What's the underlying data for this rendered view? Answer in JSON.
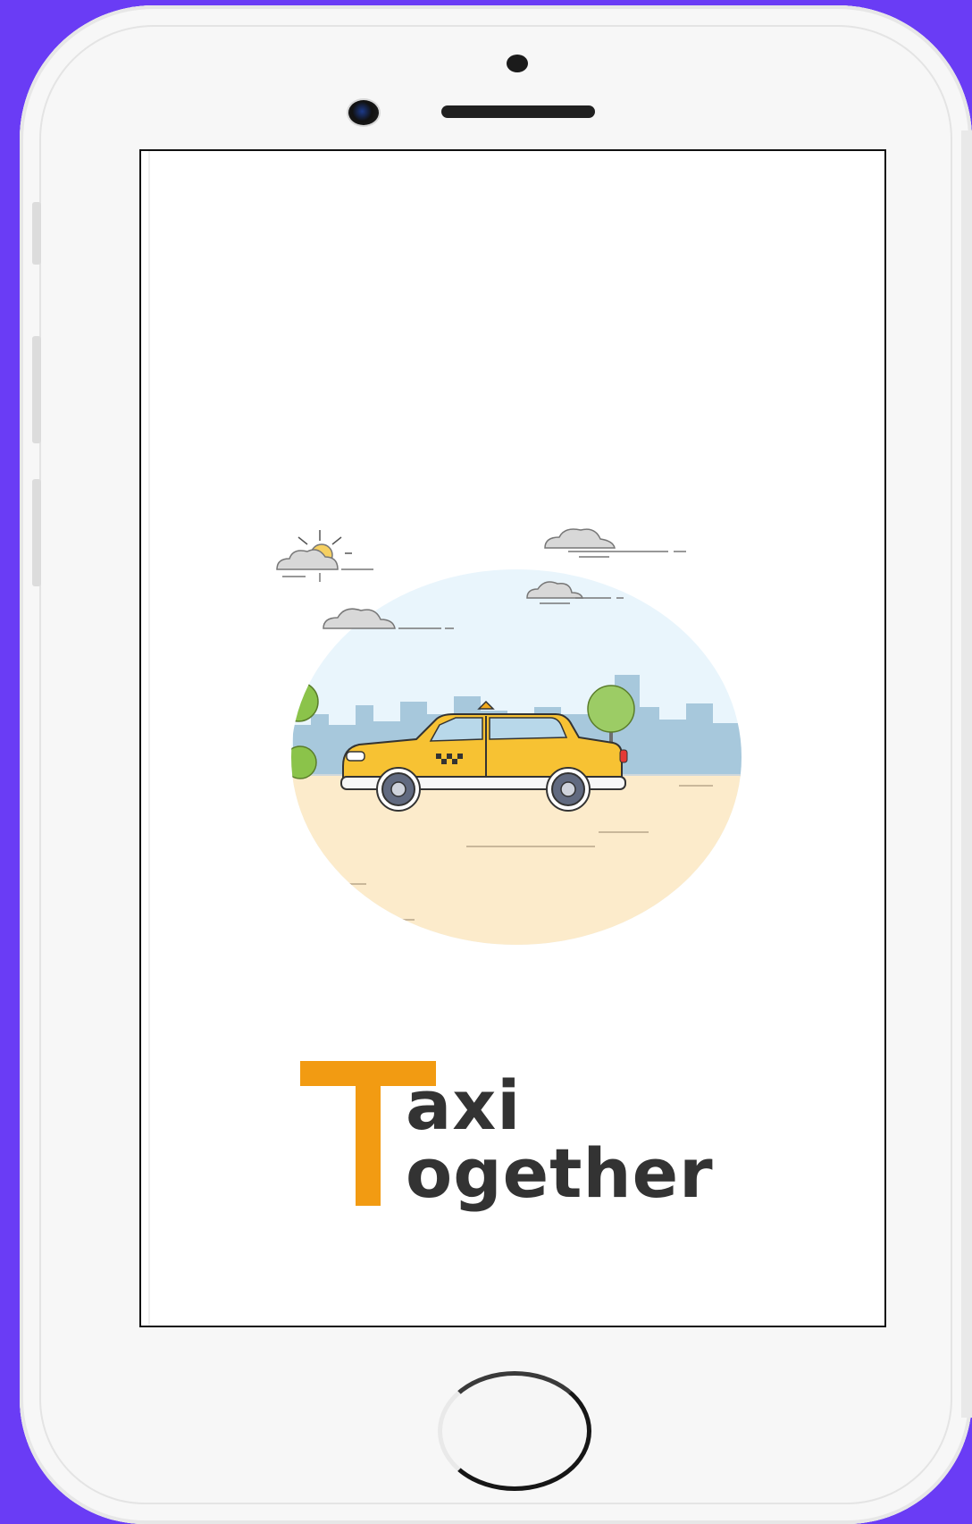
{
  "app": {
    "logo_initial": "T",
    "logo_line1": "axi",
    "logo_line2": "ogether",
    "logo_full_name": "Taxi Together"
  },
  "colors": {
    "background": "#6a3cf5",
    "accent": "#f29b12",
    "logo_text": "#333333",
    "taxi_body": "#f7c233",
    "sky": "#e8f4fb",
    "ground": "#fcebcb"
  },
  "icons": {
    "illustration": "taxi-city-illustration",
    "home": "home-button"
  }
}
